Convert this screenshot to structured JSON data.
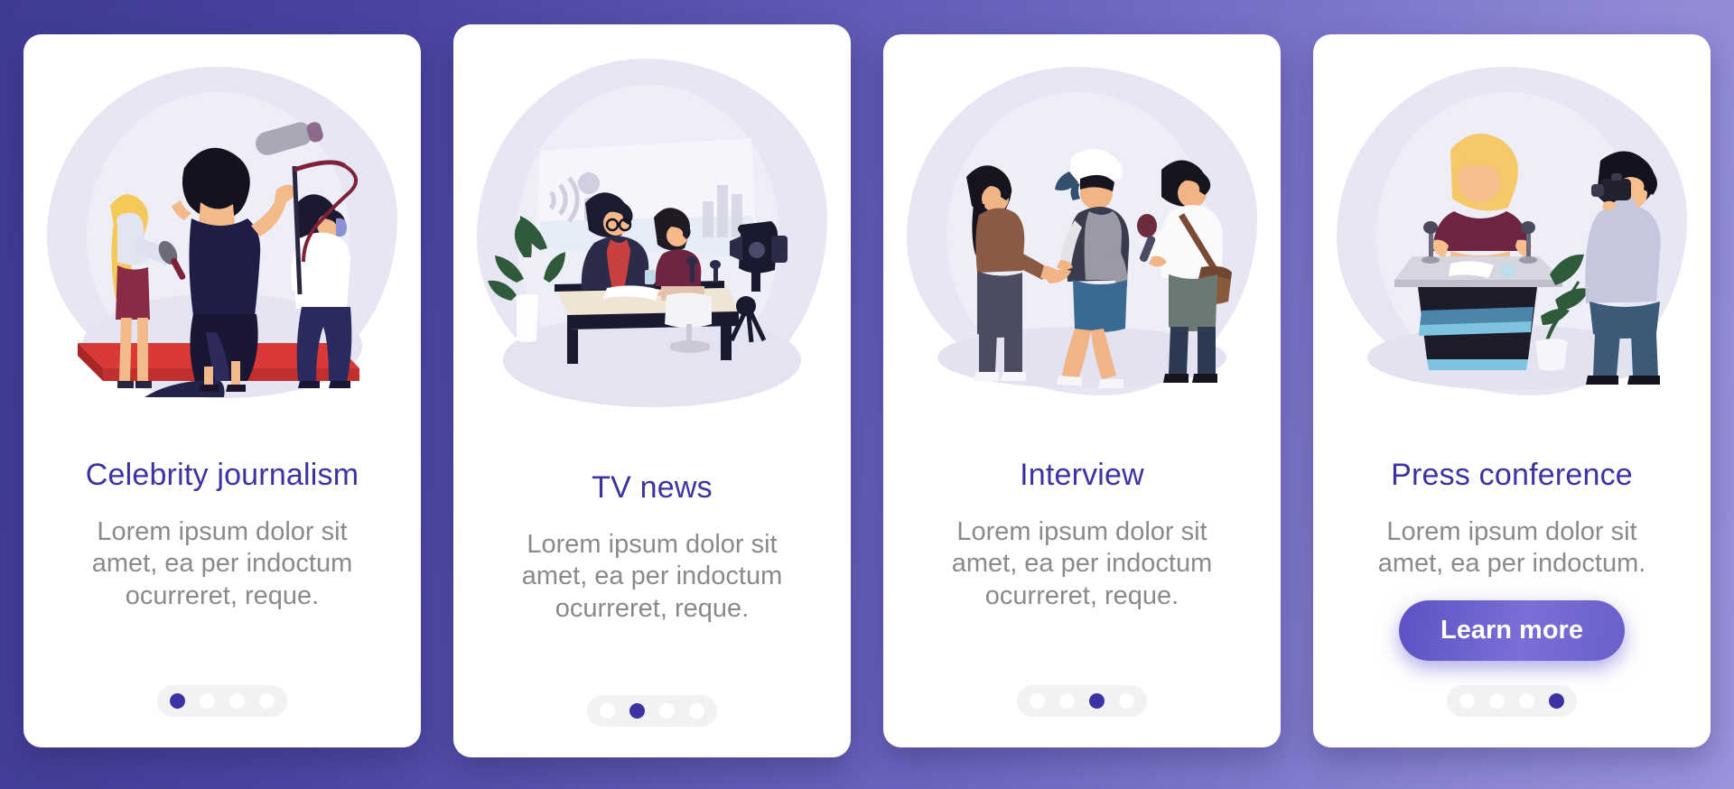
{
  "theme": {
    "background_gradient_from": "#3f3c93",
    "background_gradient_to": "#9a94dd",
    "title_color": "#3b33a3",
    "body_color": "#8a8a8a",
    "dot_active_color": "#3b33a3",
    "dot_inactive_color": "#ffffff",
    "dot_track_color": "#f2f2f5",
    "card_background": "#ffffff",
    "button_gradient_from": "#5b52c4",
    "button_gradient_to": "#7a6fd6"
  },
  "screens": [
    {
      "id": "celebrity-journalism",
      "title": "Celebrity journalism",
      "body": "Lorem ipsum dolor sit amet, ea per indoctum ocurreret, reque.",
      "illustration": "red-carpet-celebrity-interview",
      "dots": {
        "count": 4,
        "active": 0
      },
      "button": null
    },
    {
      "id": "tv-news",
      "title": "TV news",
      "body": "Lorem ipsum dolor sit amet, ea per indoctum ocurreret, reque.",
      "illustration": "tv-news-studio-desk-anchors",
      "dots": {
        "count": 4,
        "active": 1
      },
      "button": null
    },
    {
      "id": "interview",
      "title": "Interview",
      "body": "Lorem ipsum dolor sit amet, ea per indoctum ocurreret, reque.",
      "illustration": "street-interview-reporter-microphone",
      "dots": {
        "count": 4,
        "active": 2
      },
      "button": null
    },
    {
      "id": "press-conference",
      "title": "Press conference",
      "body": "Lorem ipsum dolor sit amet, ea per indoctum.",
      "illustration": "press-conference-podium-photographer",
      "dots": {
        "count": 4,
        "active": 3
      },
      "button": "Learn more"
    }
  ]
}
